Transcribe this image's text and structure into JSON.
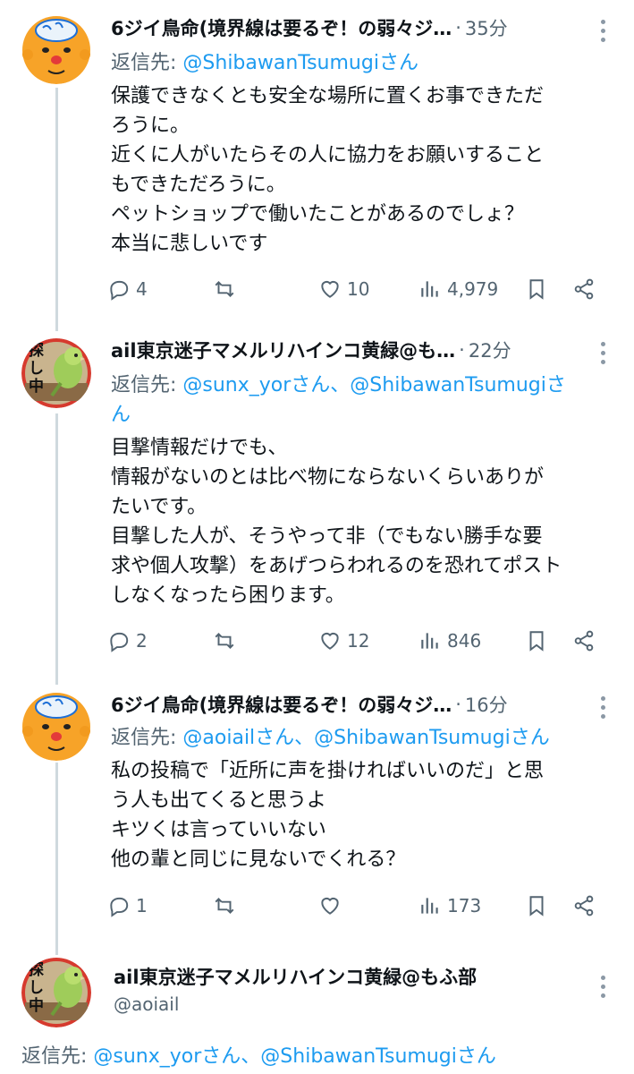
{
  "tweets": [
    {
      "name": "6ジイ鳥命(境界線は要るぞ！の弱々ジ…",
      "time": "35分",
      "reply_label": "返信先: ",
      "reply_mentions": "@ShibawanTsumugiさん",
      "body": [
        "保護できなくとも安全な場所に置くお事できただ",
        "ろうに。",
        "近くに人がいたらその人に協力をお願いすること",
        "もできただろうに。",
        "ペットショップで働いたことがあるのでしょ？",
        "本当に悲しいです"
      ],
      "replies": "4",
      "reposts": "",
      "likes": "10",
      "views": "4,979",
      "avatar_icon": "bald-man-avatar-icon"
    },
    {
      "name": "ail東京迷子マメルリハインコ黄緑@も…",
      "time": "22分",
      "reply_label": "返信先: ",
      "reply_mentions": "@sunx_yorさん、@ShibawanTsumugiさ",
      "reply_mentions_2": "ん",
      "body": [
        "目撃情報だけでも、",
        "情報がないのとは比べ物にならないくらいありが",
        "たいです。",
        "目撃した人が、そうやって非（でもない勝手な要",
        "求や個人攻撃）をあげつらわれるのを恐れてポスト",
        "しなくなったら困ります。"
      ],
      "replies": "2",
      "reposts": "",
      "likes": "12",
      "views": "846",
      "avatar_icon": "green-parakeet-avatar-icon",
      "avatar_text": [
        "探",
        "し",
        "中"
      ]
    },
    {
      "name": "6ジイ鳥命(境界線は要るぞ！の弱々ジ…",
      "time": "16分",
      "reply_label": "返信先: ",
      "reply_mentions": "@aoiailさん、@ShibawanTsumugiさん",
      "body": [
        "私の投稿で「近所に声を掛ければいいのだ」と思",
        "う人も出てくると思うよ",
        "キツくは言っていいない",
        "他の輩と同じに見ないでくれる？"
      ],
      "replies": "1",
      "reposts": "",
      "likes": "",
      "views": "173",
      "avatar_icon": "bald-man-avatar-icon"
    }
  ],
  "focused": {
    "name": "ail東京迷子マメルリハインコ黄緑@もふ部",
    "handle": "@aoiail",
    "reply_label": "返信先: ",
    "reply_mentions": "@sunx_yorさん、@ShibawanTsumugiさん",
    "avatar_text": [
      "探",
      "し",
      "中"
    ]
  },
  "colors": {
    "link": "#1d9bf0",
    "secondary": "#536471",
    "thread_line": "#cfd9de"
  }
}
